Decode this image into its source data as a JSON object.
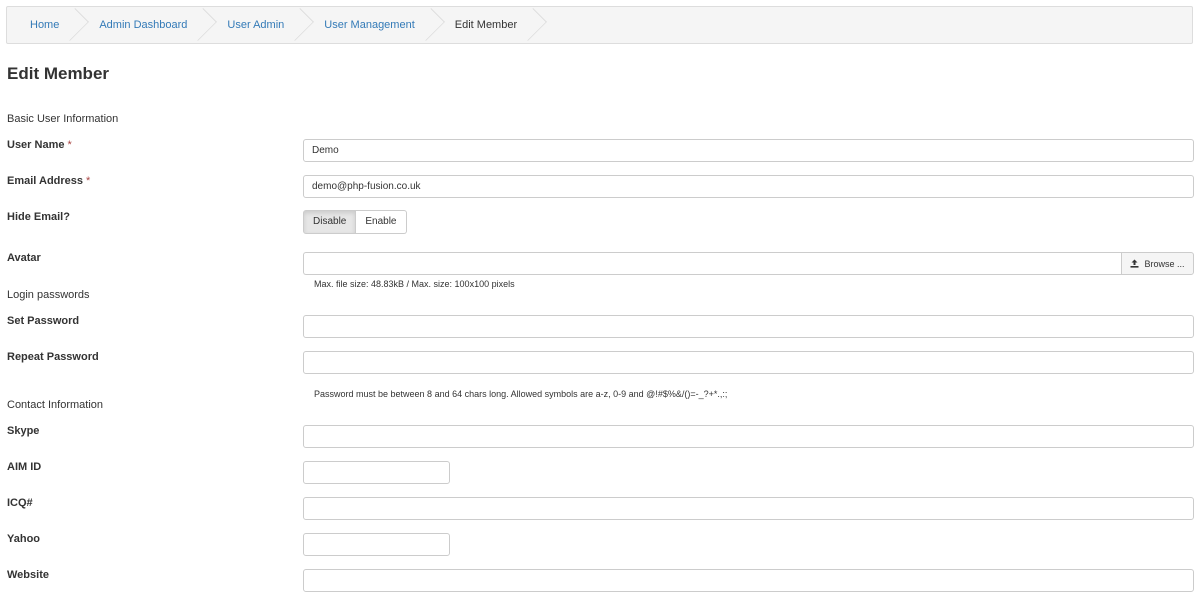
{
  "breadcrumb": {
    "items": [
      "Home",
      "Admin Dashboard",
      "User Admin",
      "User Management",
      "Edit Member"
    ]
  },
  "page": {
    "title": "Edit Member"
  },
  "sections": {
    "basic": "Basic User Information",
    "login": "Login passwords",
    "contact": "Contact Information"
  },
  "fields": {
    "user_name": {
      "label": "User Name",
      "required_mark": "*",
      "value": "Demo"
    },
    "email": {
      "label": "Email Address",
      "required_mark": "*",
      "value": "demo@php-fusion.co.uk"
    },
    "hide_email": {
      "label": "Hide Email?",
      "options": [
        "Disable",
        "Enable"
      ],
      "selected": "Disable"
    },
    "avatar": {
      "label": "Avatar",
      "browse_label": "Browse ...",
      "browse_icon": "upload-icon",
      "help": "Max. file size: 48.83kB / Max. size: 100x100 pixels"
    },
    "set_password": {
      "label": "Set Password",
      "value": ""
    },
    "repeat_password": {
      "label": "Repeat Password",
      "value": "",
      "help": "Password must be between 8 and 64 chars long. Allowed symbols are a-z, 0-9 and @!#$%&/()=-_?+*.,:;"
    },
    "skype": {
      "label": "Skype",
      "value": ""
    },
    "aim": {
      "label": "AIM ID",
      "value": ""
    },
    "icq": {
      "label": "ICQ#",
      "value": ""
    },
    "yahoo": {
      "label": "Yahoo",
      "value": ""
    },
    "website": {
      "label": "Website",
      "value": ""
    }
  },
  "colors": {
    "link": "#337ab7",
    "required": "#a94442",
    "text": "#333333"
  }
}
